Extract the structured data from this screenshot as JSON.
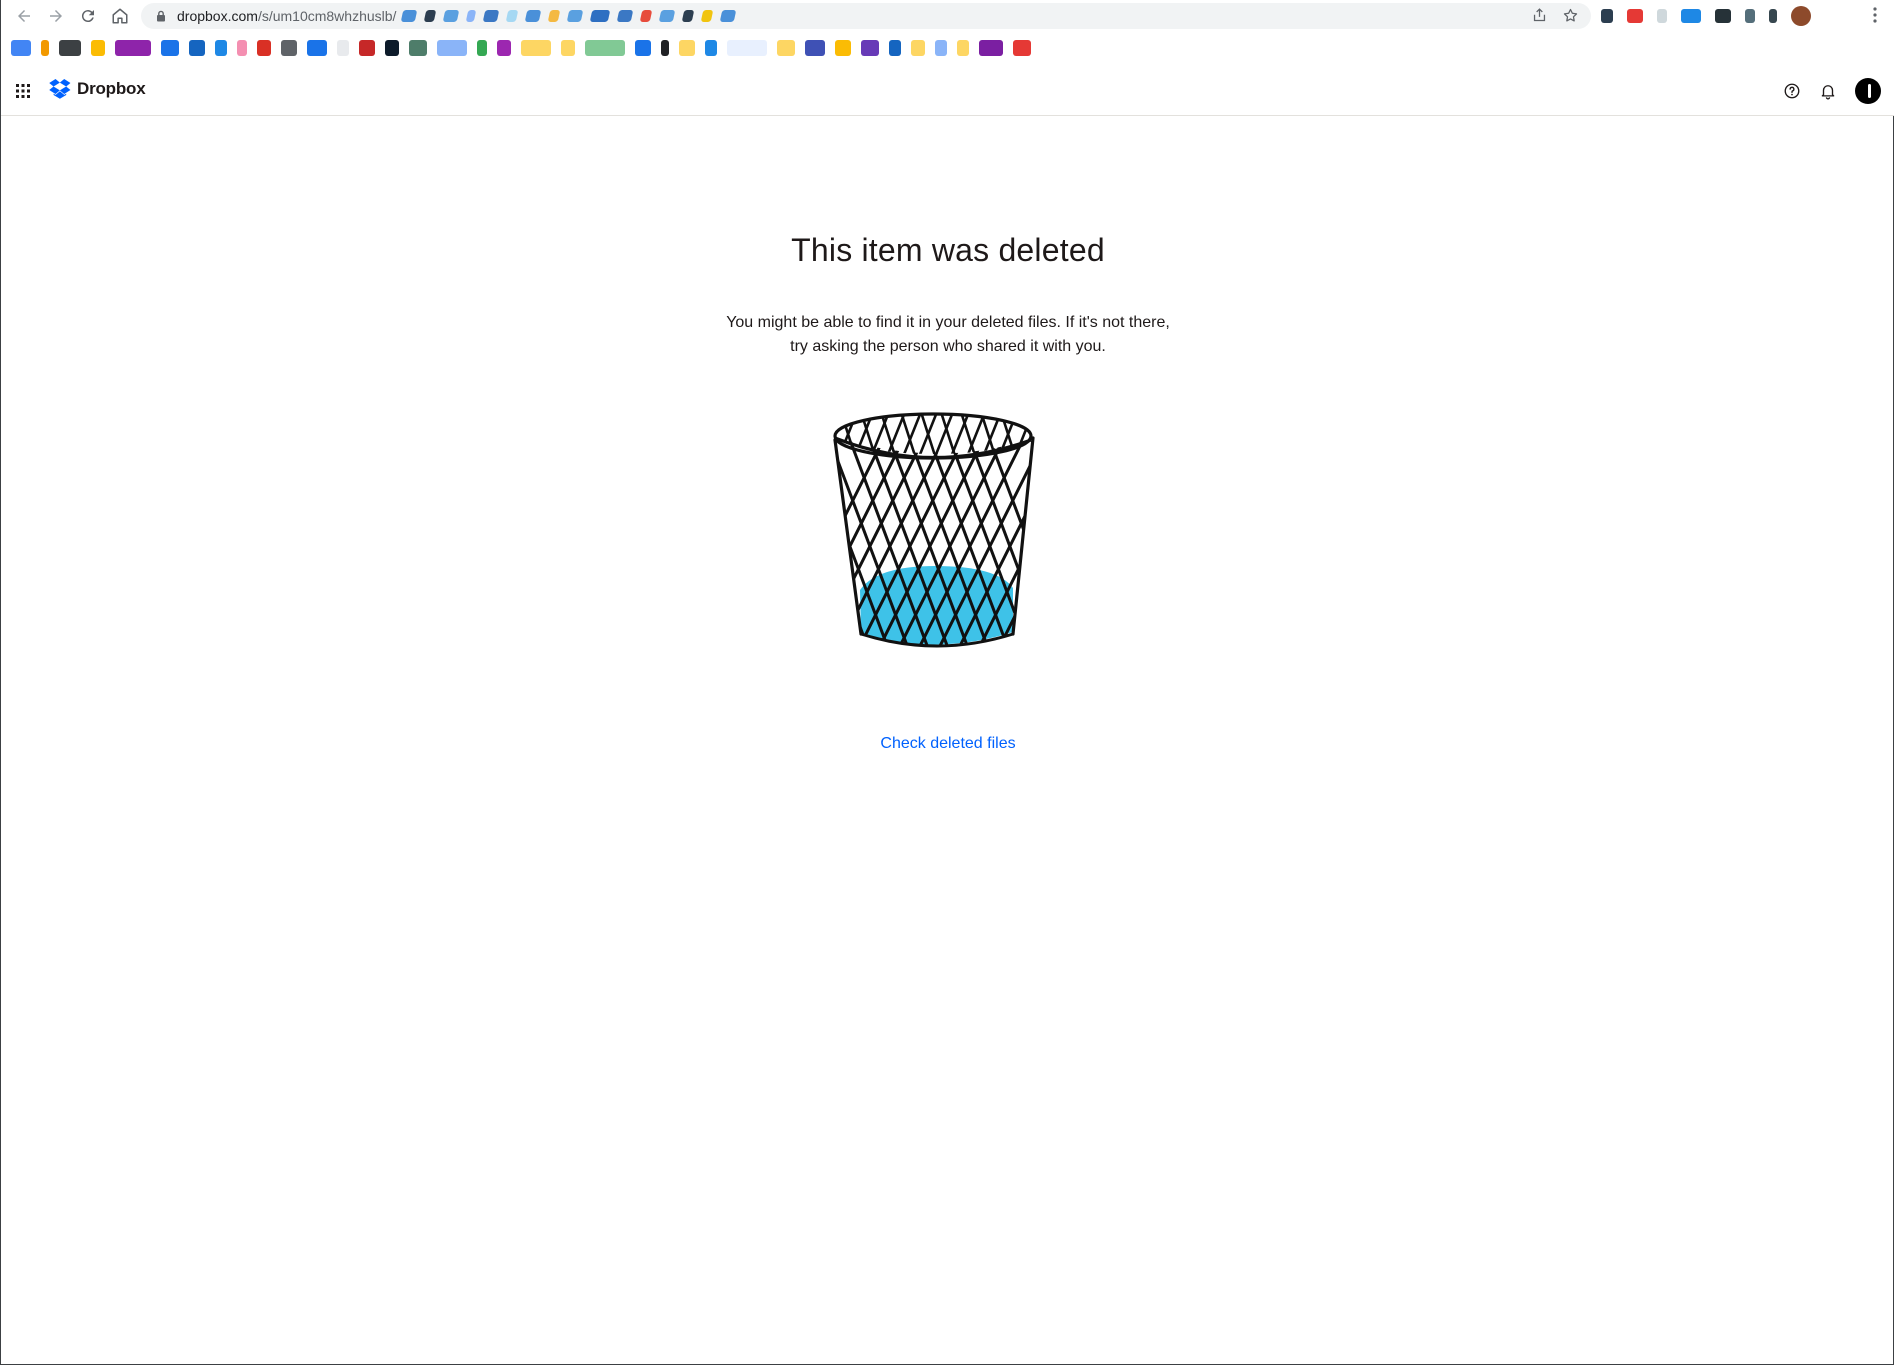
{
  "browser": {
    "url_host": "dropbox.com",
    "url_path": "/s/um10cm8whzhuslb/",
    "icons": [
      "back-arrow-icon",
      "forward-arrow-icon",
      "reload-icon",
      "home-icon",
      "lock-icon",
      "share-icon",
      "star-icon",
      "kebab-menu-icon"
    ]
  },
  "app": {
    "brand_name": "Dropbox",
    "brand_color": "#0061fe",
    "header_icons": [
      "app-grid-icon",
      "dropbox-logo-icon",
      "help-icon",
      "bell-icon",
      "avatar"
    ]
  },
  "main": {
    "title": "This item was deleted",
    "description_line1": "You might be able to find it in your deleted files. If it's not there,",
    "description_line2": "try asking the person who shared it with you.",
    "illustration": "trash-bin-illustration",
    "cta_label": "Check deleted files",
    "link_color": "#0061fe",
    "accent_color": "#3ec2e8"
  }
}
